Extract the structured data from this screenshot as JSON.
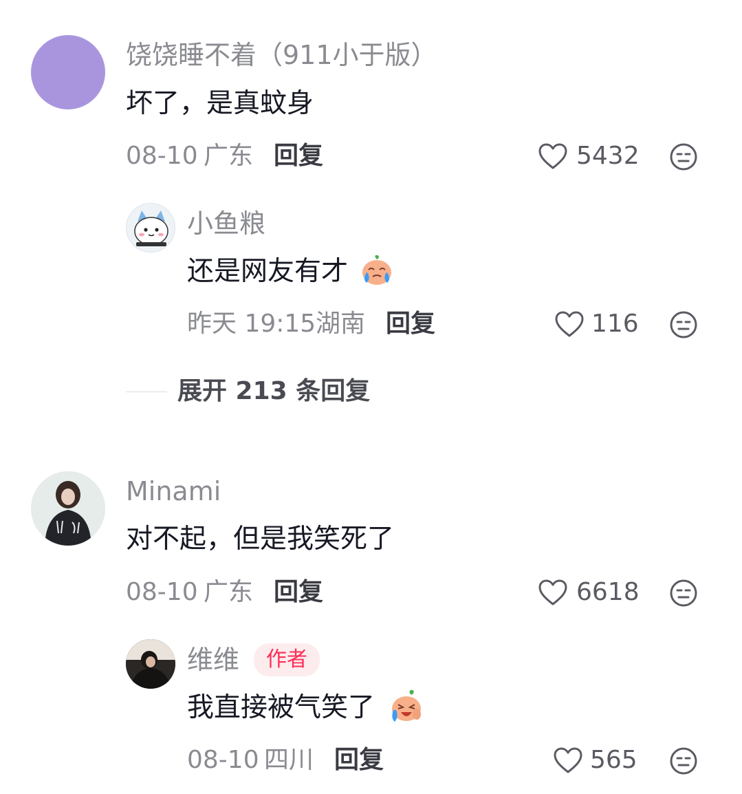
{
  "comments": [
    {
      "user": "饶饶睡不着（911小于版）",
      "text": "坏了，是真蚊身",
      "date": "08-10",
      "location": "广东",
      "reply_label": "回复",
      "likes": "5432",
      "avatar_color": "#a995de",
      "replies": [
        {
          "user": "小鱼粮",
          "text": "还是网友有才",
          "date": "昨天 19:15",
          "location": "湖南",
          "reply_label": "回复",
          "likes": "116",
          "emoji": "crying-face-emoji"
        }
      ],
      "expand_label": "展开 213 条回复"
    },
    {
      "user": "Minami",
      "text": "对不起，但是我笑死了",
      "date": "08-10",
      "location": "广东",
      "reply_label": "回复",
      "likes": "6618",
      "replies": [
        {
          "user": "维维",
          "badge": "作者",
          "text": "我直接被气笑了",
          "date": "08-10",
          "location": "四川",
          "reply_label": "回复",
          "likes": "565",
          "emoji": "laughing-crying-face-emoji"
        }
      ]
    }
  ],
  "icons": {
    "like": "heart-outline-icon",
    "dislike": "unamused-face-icon"
  },
  "colors": {
    "accent": "#fe2c55",
    "secondary_text": "#8a8b91",
    "primary_text": "#161823"
  }
}
